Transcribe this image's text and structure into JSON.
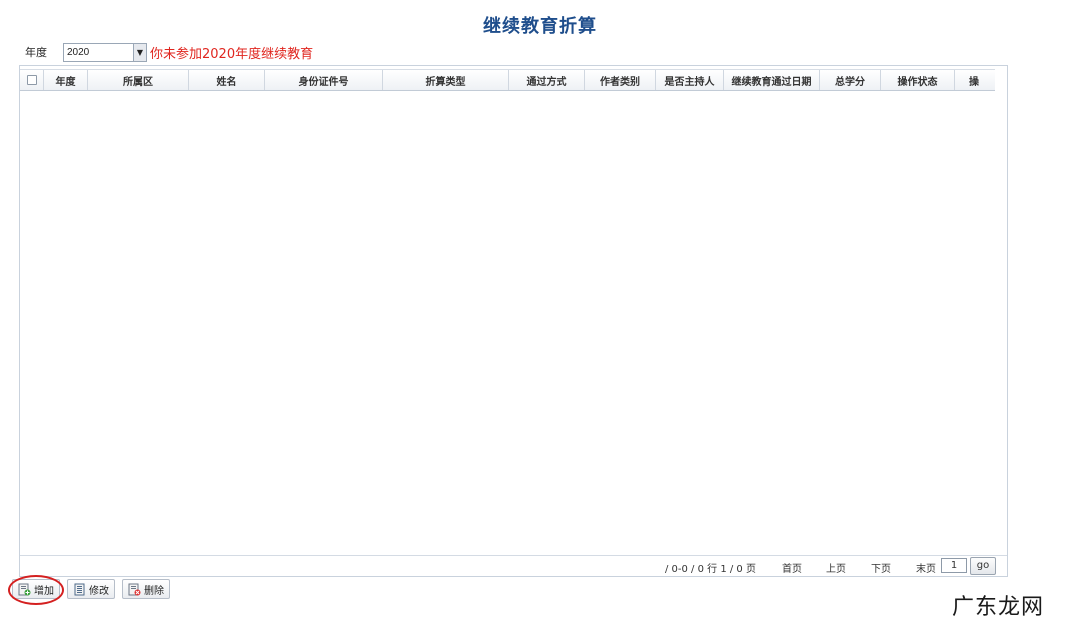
{
  "page": {
    "title": "继续教育折算"
  },
  "filter": {
    "year_label": "年度",
    "year_value": "2020",
    "notice": "你未参加2020年度继续教育",
    "notice_color": "#e0261f"
  },
  "table": {
    "columns": [
      "年度",
      "所属区",
      "姓名",
      "身份证件号",
      "折算类型",
      "通过方式",
      "作者类别",
      "是否主持人",
      "继续教育通过日期",
      "总学分",
      "操作状态",
      "操"
    ],
    "rows": []
  },
  "pager": {
    "summary": "/ 0-0 / 0 行 1 / 0 页",
    "first": "首页",
    "prev": "上页",
    "next": "下页",
    "last": "末页",
    "page_input": "1",
    "go": "go"
  },
  "toolbar": {
    "add": "增加",
    "edit": "修改",
    "delete": "删除"
  },
  "watermark": "广东龙网",
  "colors": {
    "title": "#1f4e8c",
    "highlight": "#d42020"
  }
}
